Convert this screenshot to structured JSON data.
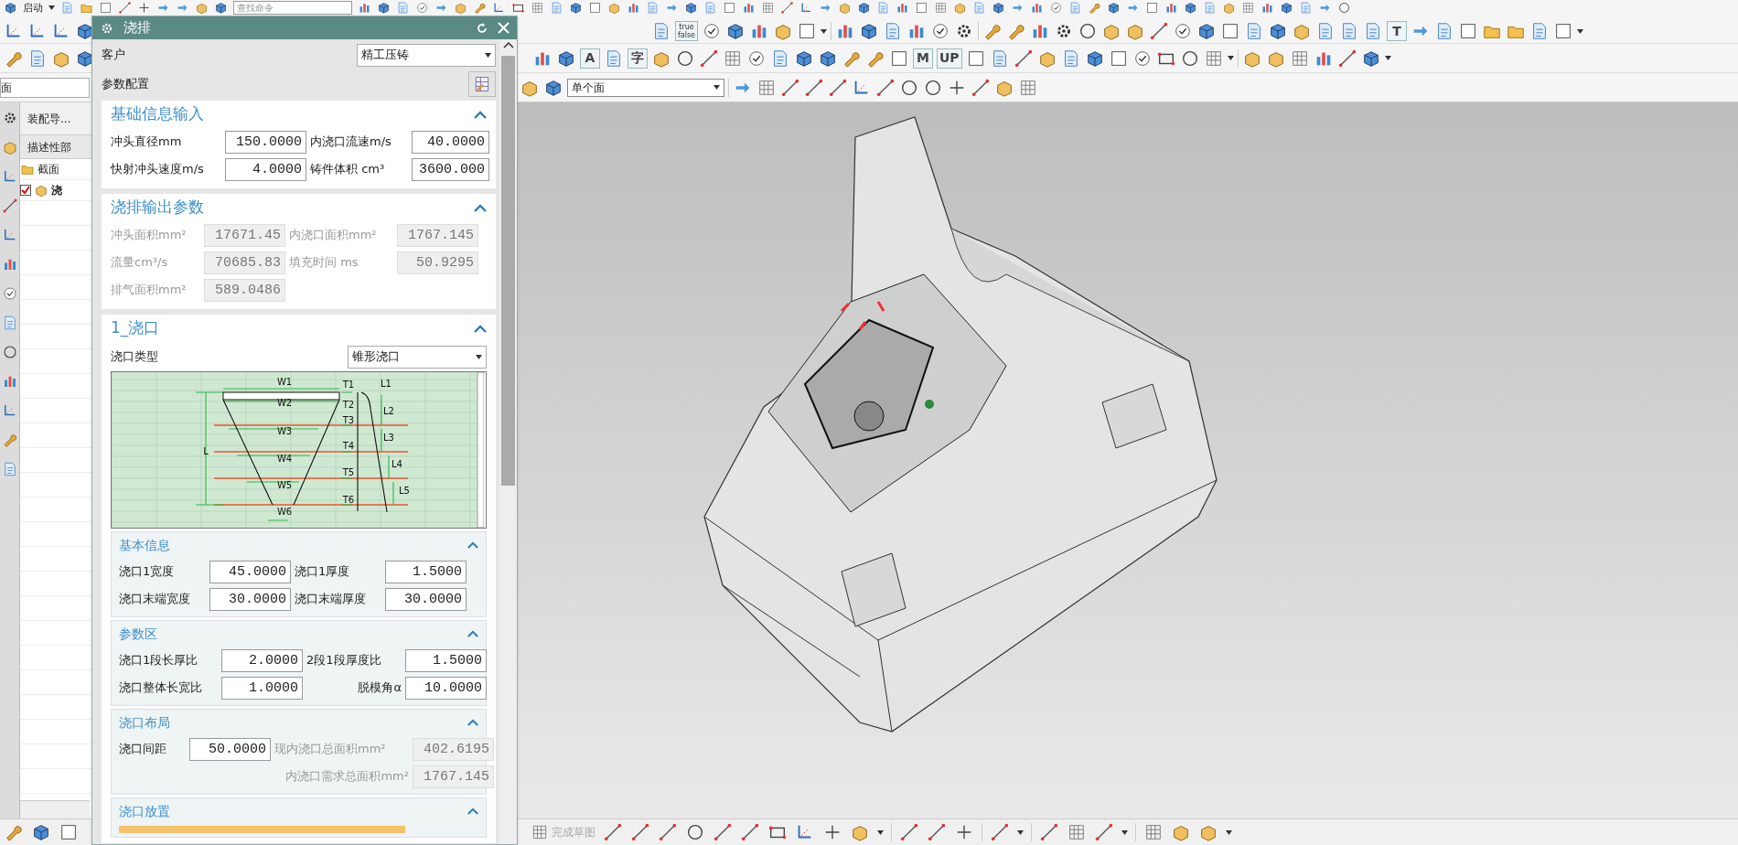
{
  "top_bar": {
    "start_menu": "启动",
    "search": {
      "placeholder": "查找命令"
    }
  },
  "toolbar_2_texts": [
    "true\nfalse",
    "T"
  ],
  "toolbar_3_texts": [
    "A",
    "字",
    "M",
    "UP"
  ],
  "selection_bar": {
    "scope_field": "面",
    "filter": "单个面"
  },
  "navigator": {
    "tab": "装配导...",
    "column": "描述性部",
    "items": [
      {
        "kind": "folder",
        "label": "截面"
      },
      {
        "kind": "part",
        "label": "浇",
        "checked": true
      }
    ]
  },
  "dialog": {
    "title": "浇排",
    "customer": {
      "label": "客户",
      "value": "精工压铸"
    },
    "config": {
      "label": "参数配置"
    },
    "sections": [
      {
        "title": "基础信息输入",
        "expanded": true,
        "rows": [
          [
            {
              "label": "冲头直径mm",
              "value": "150.0000",
              "disabled": false
            },
            {
              "label": "内浇口流速m/s",
              "value": "40.0000",
              "disabled": false
            }
          ],
          [
            {
              "label": "快射冲头速度m/s",
              "value": "4.0000",
              "disabled": false
            },
            {
              "label": "铸件体积 cm³",
              "value": "3600.000",
              "disabled": false
            }
          ]
        ]
      },
      {
        "title": "浇排输出参数",
        "expanded": true,
        "rows": [
          [
            {
              "label": "冲头面积mm²",
              "value": "17671.45",
              "disabled": true
            },
            {
              "label": "内浇口面积mm²",
              "value": "1767.145",
              "disabled": true
            }
          ],
          [
            {
              "label": "流量cm³/s",
              "value": "70685.83",
              "disabled": true
            },
            {
              "label": "填充时间 ms",
              "value": "50.9295",
              "disabled": true
            }
          ],
          [
            {
              "label": "排气面积mm²",
              "value": "589.0486",
              "disabled": true
            }
          ]
        ]
      },
      {
        "title": "1_浇口",
        "expanded": true,
        "gate_type": {
          "label": "浇口类型",
          "value": "锥形浇口"
        },
        "diagram_labels": [
          "W1",
          "W2",
          "W3",
          "W4",
          "W5",
          "W6",
          "L",
          "T1",
          "T2",
          "T3",
          "T4",
          "T5",
          "T6",
          "L1",
          "L2",
          "L3",
          "L4",
          "L5"
        ],
        "subsections": [
          {
            "title": "基本信息",
            "expanded": true,
            "rows": [
              [
                {
                  "label": "浇口1宽度",
                  "value": "45.0000",
                  "disabled": false
                },
                {
                  "label": "浇口1厚度",
                  "value": "1.5000",
                  "disabled": false
                }
              ],
              [
                {
                  "label": "浇口末端宽度",
                  "value": "30.0000",
                  "disabled": false
                },
                {
                  "label": "浇口末端厚度",
                  "value": "30.0000",
                  "disabled": false
                }
              ]
            ]
          },
          {
            "title": "参数区",
            "expanded": true,
            "rows": [
              [
                {
                  "label": "浇口1段长厚比",
                  "value": "2.0000",
                  "disabled": false
                },
                {
                  "label": "2段1段厚度比",
                  "value": "1.5000",
                  "disabled": false
                }
              ],
              [
                {
                  "label": "浇口整体长宽比",
                  "value": "1.0000",
                  "disabled": false
                },
                {
                  "label": "脱模角α",
                  "value": "10.0000",
                  "disabled": false
                }
              ]
            ]
          },
          {
            "title": "浇口布局",
            "expanded": true,
            "rows": [
              [
                {
                  "label": "浇口间距",
                  "value": "50.0000",
                  "disabled": false
                },
                {
                  "label": "现内浇口总面积mm²",
                  "value": "402.6195",
                  "disabled": true
                }
              ],
              [
                "",
                {
                  "label": "内浇口需求总面积mm²",
                  "value": "1767.145",
                  "disabled": true
                }
              ]
            ]
          },
          {
            "title": "浇口放置",
            "expanded": true
          }
        ]
      }
    ]
  },
  "sketch_bar": {
    "finish_sketch": {
      "label": "完成草图",
      "disabled": true
    }
  }
}
